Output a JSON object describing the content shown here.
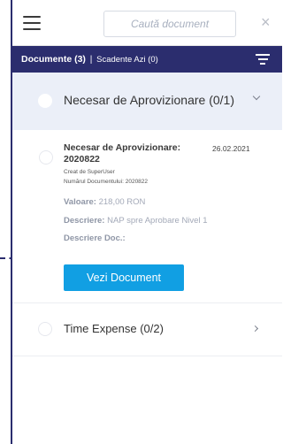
{
  "topbar": {
    "search_placeholder": "Caută document",
    "close_symbol": "×",
    "menu_icon": "hamburger-menu-icon"
  },
  "tabs": {
    "active": "Documente (3)",
    "separator": "|",
    "inactive": "Scadente Azi (0)",
    "filter_icon": "filter-icon"
  },
  "groups": [
    {
      "label": "Necesar de Aprovizionare (0/1)",
      "expanded": true
    },
    {
      "label": "Time Expense (0/2)",
      "expanded": false
    }
  ],
  "document": {
    "title": "Necesar de Aprovizionare: 2020822",
    "date": "26.02.2021",
    "created_by": "Creat de SuperUser",
    "doc_number": "Numărul Documentului: 2020822",
    "value_label": "Valoare:",
    "value": "218,00 RON",
    "description_label": "Descriere:",
    "description": "NAP spre Aprobare Nivel 1",
    "doc_description_label": "Descriere Doc.:",
    "button_label": "Vezi Document"
  },
  "colors": {
    "nav_bar": "#2b2d6e",
    "primary_button": "#119fe3",
    "group_header_bg": "#ebeff8"
  }
}
